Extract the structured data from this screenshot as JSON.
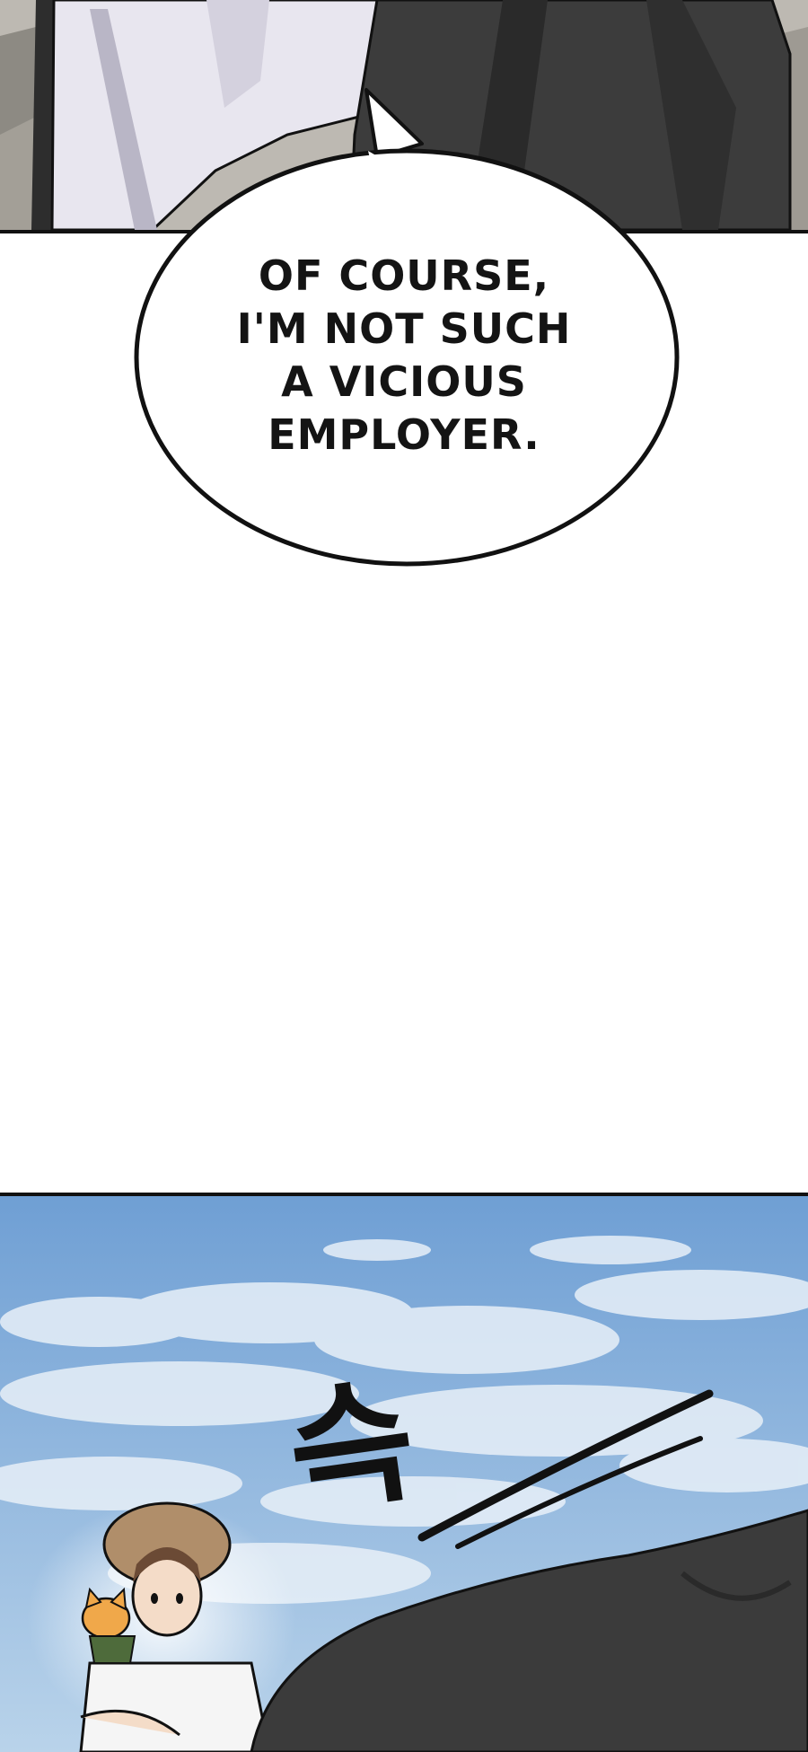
{
  "speech_bubble": {
    "lines": [
      "OF COURSE,",
      "I'M NOT SUCH",
      "A VICIOUS",
      "EMPLOYER."
    ]
  },
  "sound_effect": {
    "text": "슥"
  },
  "colors": {
    "sky_top": "#6f9fd4",
    "sky_bottom": "#b9d3ea",
    "rock": "#3b3b3b",
    "coat_dark": "#3a3a3a",
    "coat_light": "#e7e5ef"
  }
}
